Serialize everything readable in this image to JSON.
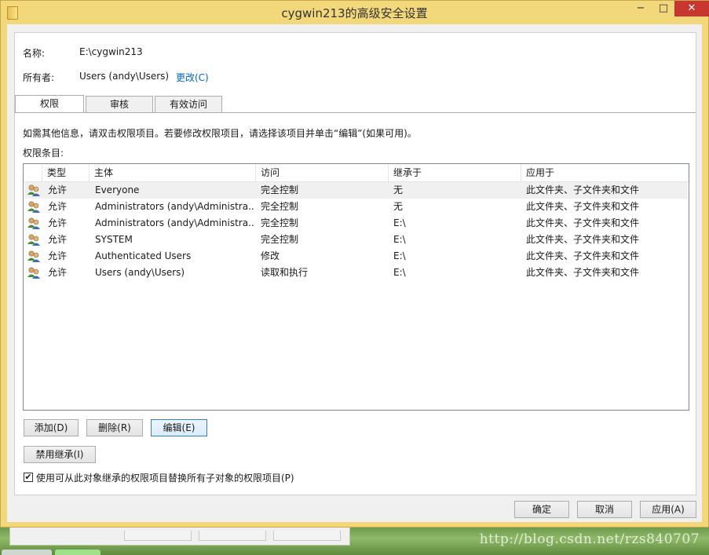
{
  "window": {
    "title": "cygwin213的高级安全设置",
    "minimize": "−",
    "maximize": "□",
    "close": "✕"
  },
  "info": {
    "name_label": "名称:",
    "name_value": "E:\\cygwin213",
    "owner_label": "所有者:",
    "owner_value": "Users (andy\\Users)",
    "change_link": "更改(C)"
  },
  "tabs": [
    {
      "label": "权限",
      "active": true
    },
    {
      "label": "审核",
      "active": false
    },
    {
      "label": "有效访问",
      "active": false
    }
  ],
  "instructions": "如需其他信息，请双击权限项目。若要修改权限项目，请选择该项目并单击“编辑”(如果可用)。",
  "entries_label": "权限条目:",
  "table": {
    "columns": [
      "类型",
      "主体",
      "访问",
      "继承于",
      "应用于"
    ],
    "rows": [
      {
        "type": "允许",
        "principal": "Everyone",
        "access": "完全控制",
        "inherited": "无",
        "applies": "此文件夹、子文件夹和文件"
      },
      {
        "type": "允许",
        "principal": "Administrators (andy\\Administra...",
        "access": "完全控制",
        "inherited": "无",
        "applies": "此文件夹、子文件夹和文件"
      },
      {
        "type": "允许",
        "principal": "Administrators (andy\\Administra...",
        "access": "完全控制",
        "inherited": "E:\\",
        "applies": "此文件夹、子文件夹和文件"
      },
      {
        "type": "允许",
        "principal": "SYSTEM",
        "access": "完全控制",
        "inherited": "E:\\",
        "applies": "此文件夹、子文件夹和文件"
      },
      {
        "type": "允许",
        "principal": "Authenticated Users",
        "access": "修改",
        "inherited": "E:\\",
        "applies": "此文件夹、子文件夹和文件"
      },
      {
        "type": "允许",
        "principal": "Users (andy\\Users)",
        "access": "读取和执行",
        "inherited": "E:\\",
        "applies": "此文件夹、子文件夹和文件"
      }
    ]
  },
  "buttons": {
    "add": "添加(D)",
    "remove": "删除(R)",
    "edit": "编辑(E)",
    "disable_inheritance": "禁用继承(I)",
    "ok": "确定",
    "cancel": "取消",
    "apply": "应用(A)"
  },
  "replace_checkbox": {
    "label": "使用可从此对象继承的权限项目替换所有子对象的权限项目(P)",
    "checked": true
  },
  "watermark": "http://blog.csdn.net/rzs840707",
  "colors": {
    "title_bar": "#f2d77b",
    "close_button": "#c7372f",
    "link": "#0066cc",
    "focused_button_border": "#3c7fb1"
  }
}
